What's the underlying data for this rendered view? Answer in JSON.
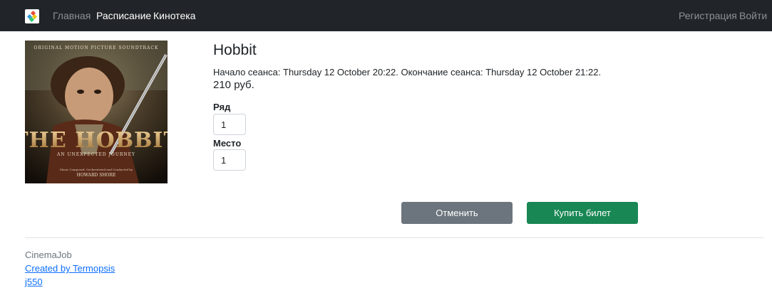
{
  "navbar": {
    "links": [
      "Главная",
      "Расписание",
      "Кинотека"
    ],
    "auth": [
      "Регистрация",
      "Войти"
    ]
  },
  "poster": {
    "top_text": "ORIGINAL MOTION PICTURE SOUNDTRACK",
    "logo": "THE HOBBIT",
    "subtitle": "AN UNEXPECTED JOURNEY",
    "credit": "Music Composed, Orchestrated and Conducted by",
    "composer": "HOWARD SHORE"
  },
  "movie": {
    "title": "Hobbit",
    "session": "Начало сеанса: Thursday 12 October 20:22. Окончание сеанса: Thursday 12 October 21:22.",
    "price": "210 руб."
  },
  "form": {
    "row_label": "Ряд",
    "row_value": "1",
    "seat_label": "Место",
    "seat_value": "1"
  },
  "actions": {
    "cancel": "Отменить",
    "buy": "Купить билет"
  },
  "footer": {
    "name": "CinemaJob",
    "credit": "Created by Termopsis",
    "handle": "j550"
  },
  "colors": {
    "navbar": "#212529",
    "cancel": "#6c757d",
    "buy": "#198754",
    "link": "#0d6efd"
  }
}
